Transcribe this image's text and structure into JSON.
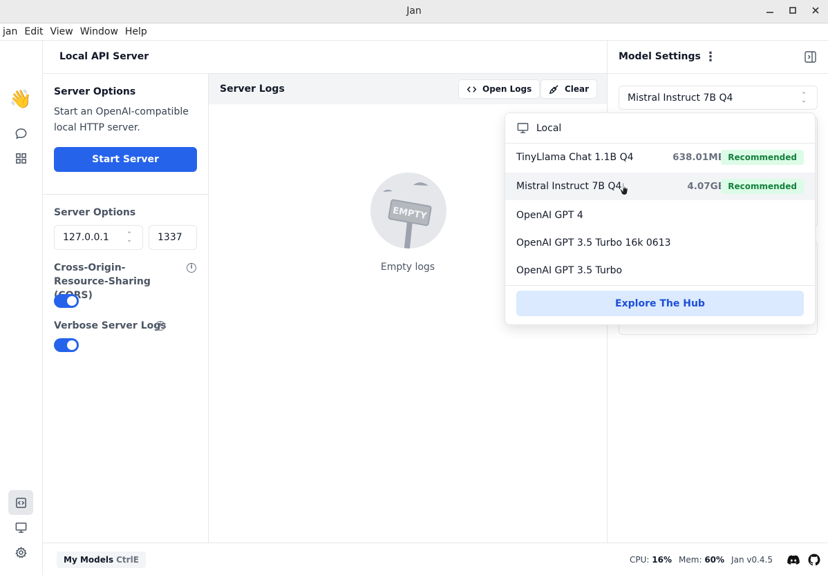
{
  "window": {
    "title": "Jan"
  },
  "menu": [
    "jan",
    "Edit",
    "View",
    "Window",
    "Help"
  ],
  "header": {
    "title": "Local API Server"
  },
  "rail": {
    "hand_emoji": "👋"
  },
  "server_options": {
    "title": "Server Options",
    "description": "Start an OpenAI-compatible local HTTP server.",
    "start_button": "Start Server",
    "section_label": "Server Options",
    "host": "127.0.0.1",
    "port": "1337",
    "cors_label": "Cross-Origin-Resource-Sharing (CORS)",
    "cors_enabled": true,
    "verbose_label": "Verbose Server Logs",
    "verbose_enabled": true,
    "info_glyph": "i"
  },
  "logs": {
    "title": "Server Logs",
    "open_logs": "Open Logs",
    "clear": "Clear",
    "empty_sign": "EMPTY",
    "empty_text": "Empty logs"
  },
  "model_settings": {
    "title": "Model Settings",
    "selected_model": "Mistral Instruct 7B Q4"
  },
  "dropdown": {
    "header": "Local",
    "models": [
      {
        "name": "TinyLlama Chat 1.1B Q4",
        "size": "638.01MB",
        "badge": "Recommended"
      },
      {
        "name": "Mistral Instruct 7B Q4",
        "size": "4.07GB",
        "badge": "Recommended"
      },
      {
        "name": "OpenAI GPT 4",
        "size": "",
        "badge": ""
      },
      {
        "name": "OpenAI GPT 3.5 Turbo 16k 0613",
        "size": "",
        "badge": ""
      },
      {
        "name": "OpenAI GPT 3.5 Turbo",
        "size": "",
        "badge": ""
      }
    ],
    "explore": "Explore The Hub"
  },
  "footer": {
    "my_models": "My Models",
    "shortcut": "CtrlE",
    "cpu_label": "CPU:",
    "cpu_value": "16%",
    "mem_label": "Mem:",
    "mem_value": "60%",
    "version": "Jan v0.4.5"
  },
  "colors": {
    "accent": "#2563eb",
    "badge_bg": "#dcfce7",
    "badge_text": "#15803d",
    "hub_bg": "#dbeafe"
  }
}
